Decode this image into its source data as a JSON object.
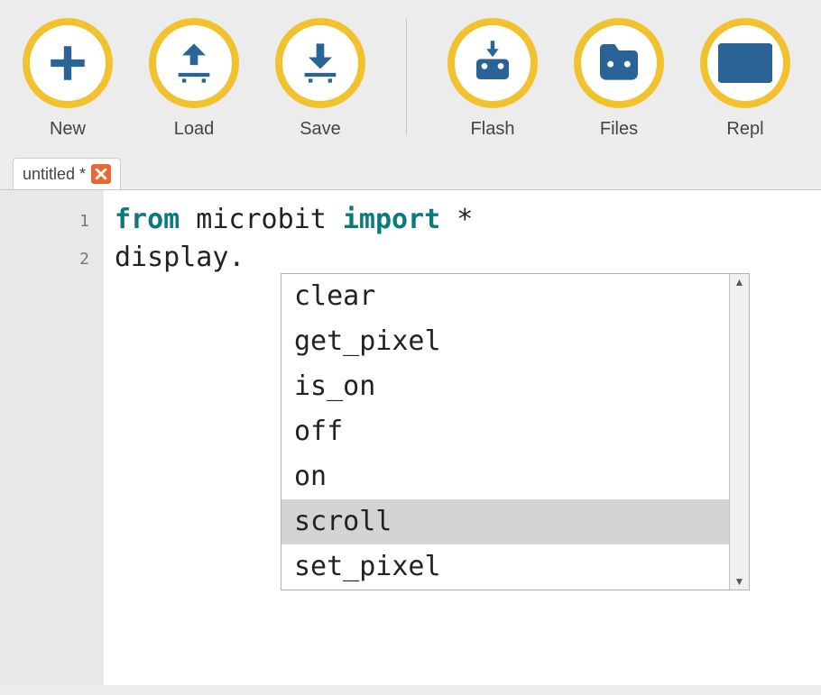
{
  "toolbar": {
    "new": "New",
    "load": "Load",
    "save": "Save",
    "flash": "Flash",
    "files": "Files",
    "repl": "Repl"
  },
  "tab": {
    "title": "untitled *"
  },
  "editor": {
    "lines": [
      "1",
      "2"
    ],
    "code": {
      "kw_from": "from",
      "module": " microbit ",
      "kw_import": "import",
      "star": " *",
      "line2": "display."
    }
  },
  "autocomplete": {
    "items": [
      {
        "label": "clear",
        "selected": false
      },
      {
        "label": "get_pixel",
        "selected": false
      },
      {
        "label": "is_on",
        "selected": false
      },
      {
        "label": "off",
        "selected": false
      },
      {
        "label": "on",
        "selected": false
      },
      {
        "label": "scroll",
        "selected": true
      },
      {
        "label": "set_pixel",
        "selected": false
      }
    ]
  }
}
